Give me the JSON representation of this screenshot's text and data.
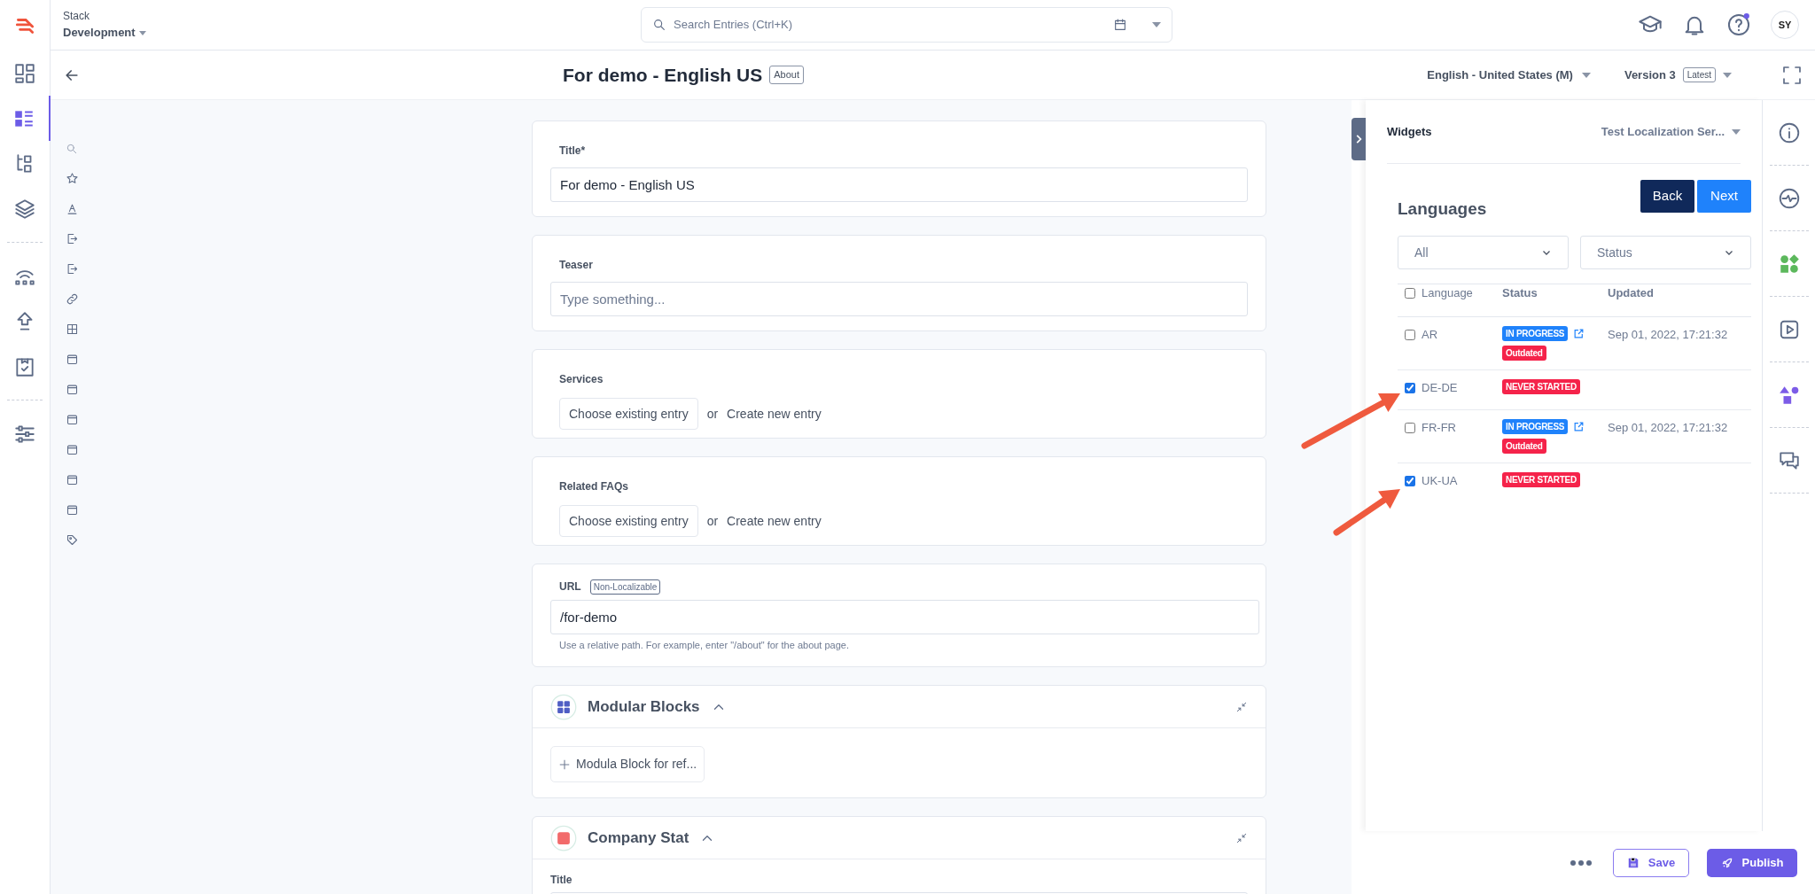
{
  "stack": {
    "label": "Stack",
    "branch": "Development"
  },
  "search": {
    "placeholder": "Search Entries (Ctrl+K)"
  },
  "user": {
    "initials": "SY"
  },
  "nav": [
    {
      "selected": false
    },
    {
      "selected": true
    },
    {
      "selected": false
    },
    {
      "selected": false
    },
    {
      "selected": false
    },
    {
      "selected": false
    },
    {
      "selected": false
    },
    {
      "selected": false
    }
  ],
  "entry": {
    "title": "For demo - English US",
    "content_type": "About",
    "locale": "English - United States (M)",
    "version": "Version 3",
    "version_badge": "Latest"
  },
  "fields": [
    {
      "kind": "text",
      "label": "Title*",
      "value": "For demo - English US"
    },
    {
      "kind": "text",
      "label": "Teaser",
      "placeholder": "Type something..."
    },
    {
      "kind": "reference",
      "label": "Services",
      "choose": "Choose existing entry",
      "or": "or",
      "create": "Create new entry"
    },
    {
      "kind": "reference",
      "label": "Related FAQs",
      "choose": "Choose existing entry",
      "or": "or",
      "create": "Create new entry"
    },
    {
      "kind": "url",
      "label": "URL",
      "badge": "Non-Localizable",
      "value": "/for-demo",
      "help": "Use a relative path. For example, enter \"/about\" for the about page."
    },
    {
      "kind": "blocks",
      "label": "Modular Blocks",
      "color": "#4f5ec4",
      "add": "Modula Block for ref..."
    },
    {
      "kind": "group",
      "label": "Company Stat",
      "color": "#f26b6b",
      "sub_label": "Title"
    }
  ],
  "widgets": {
    "title": "Widgets",
    "app": "Test Localization Ser...",
    "heading": "Languages",
    "back": "Back",
    "next": "Next",
    "filters": [
      "All",
      "Status"
    ],
    "columns": [
      "Language",
      "Status",
      "Updated"
    ],
    "all_checked": false,
    "rows": [
      {
        "language": "AR",
        "checked": false,
        "statuses": [
          {
            "label": "IN PROGRESS",
            "kind": "progress"
          },
          {
            "label": "Outdated",
            "kind": "alert"
          }
        ],
        "external_link": true,
        "updated": "Sep 01, 2022, 17:21:32"
      },
      {
        "language": "DE-DE",
        "checked": true,
        "statuses": [
          {
            "label": "NEVER STARTED",
            "kind": "alert"
          }
        ],
        "external_link": false
      },
      {
        "language": "FR-FR",
        "checked": false,
        "statuses": [
          {
            "label": "IN PROGRESS",
            "kind": "progress"
          },
          {
            "label": "Outdated",
            "kind": "alert"
          }
        ],
        "external_link": true,
        "updated": "Sep 01, 2022, 17:21:32"
      },
      {
        "language": "UK-UA",
        "checked": true,
        "statuses": [
          {
            "label": "NEVER STARTED",
            "kind": "alert"
          }
        ],
        "external_link": false
      }
    ]
  },
  "actions": {
    "save": "Save",
    "publish": "Publish"
  }
}
